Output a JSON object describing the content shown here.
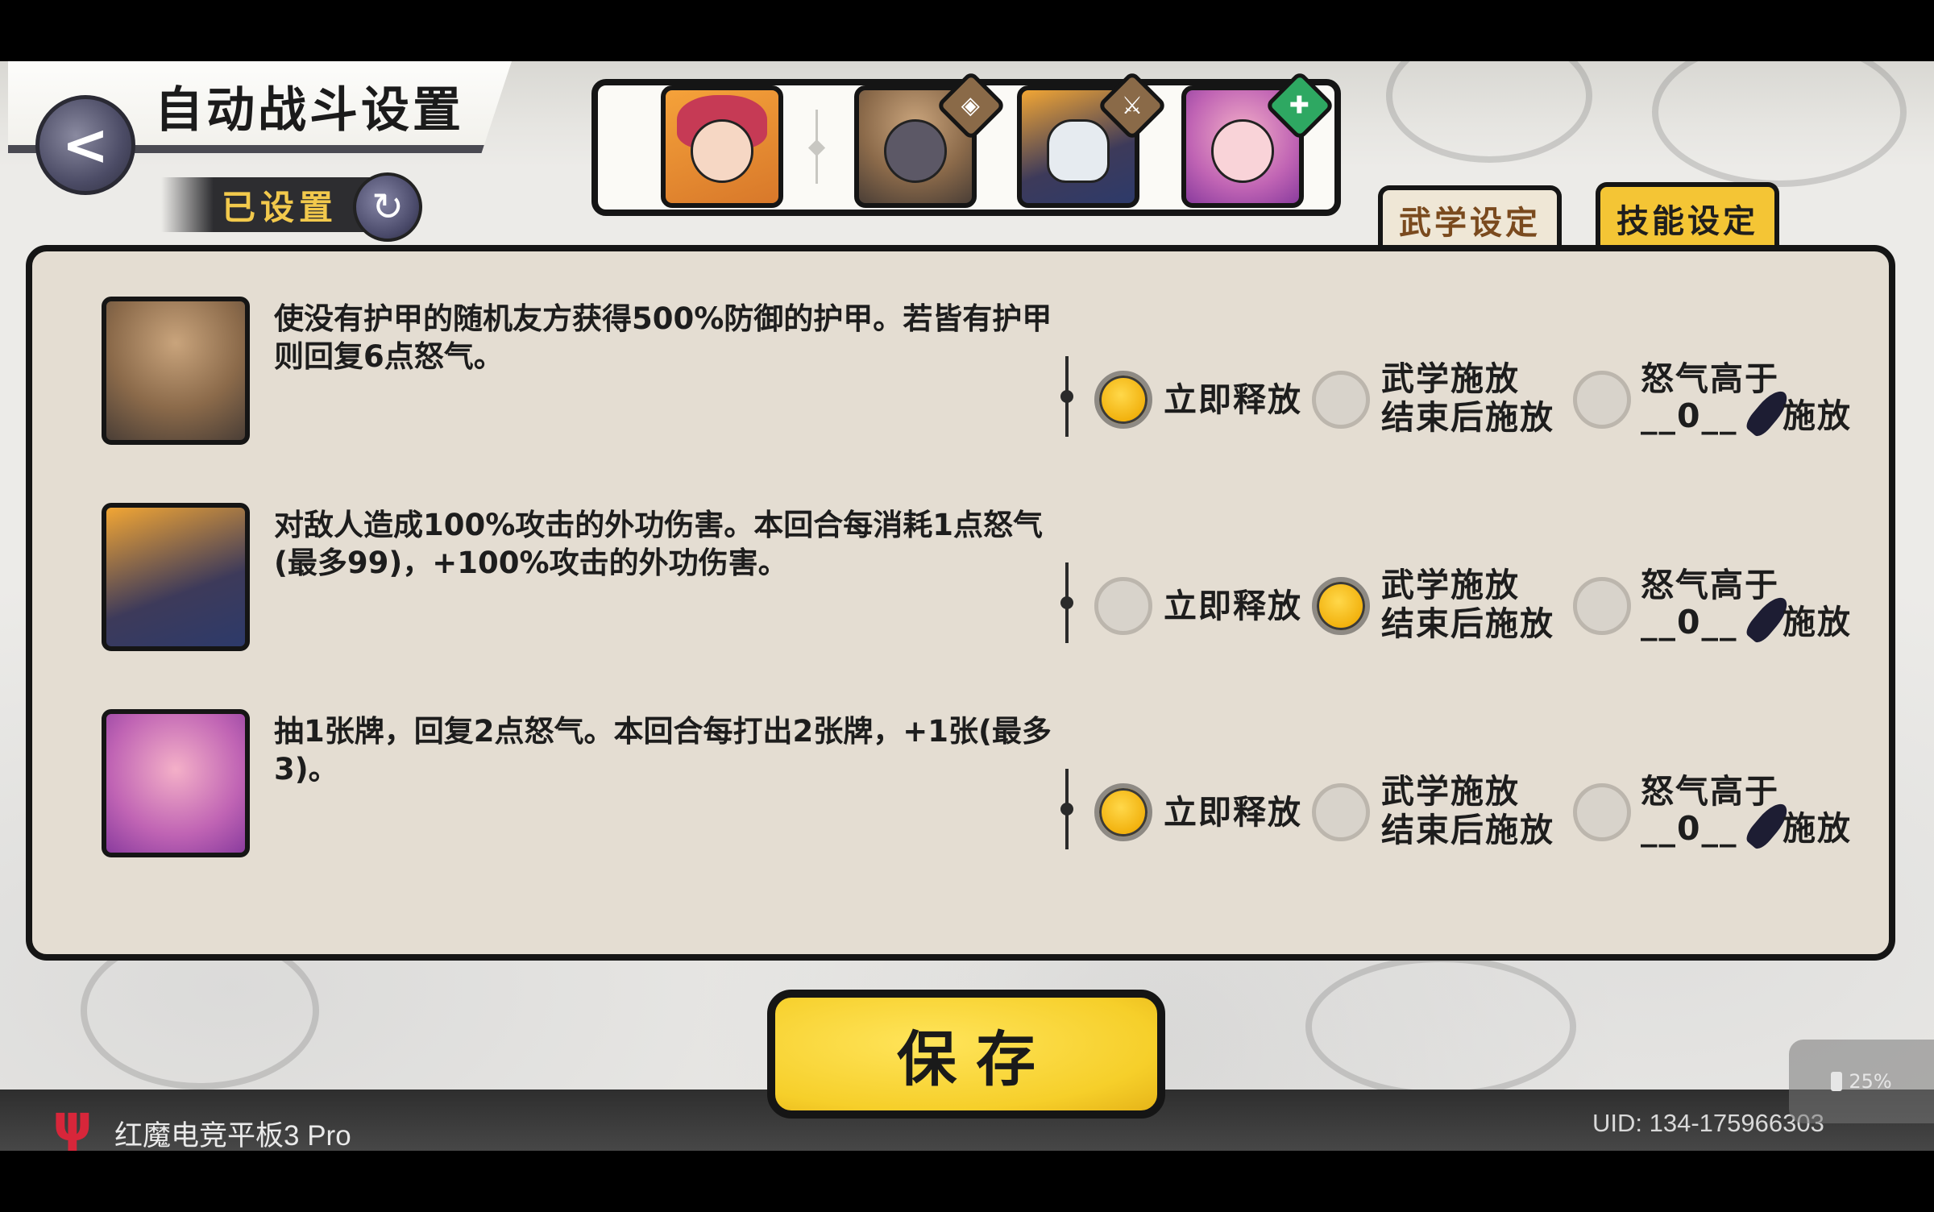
{
  "header": {
    "title": "自动战斗设置",
    "status_label": "已设置",
    "back_glyph": "<",
    "status_glyph": "↻"
  },
  "tabs": [
    {
      "label": "武学设定",
      "active": false
    },
    {
      "label": "技能设定",
      "active": true
    }
  ],
  "skills": [
    {
      "description": "使没有护甲的随机友方获得500%防御的护甲。若皆有护甲则回复6点怒气。",
      "selected": "immediate"
    },
    {
      "description": "对敌人造成100%攻击的外功伤害。本回合每消耗1点怒气(最多99)，+100%攻击的外功伤害。",
      "selected": "after_martial"
    },
    {
      "description": "抽1张牌，回复2点怒气。本回合每打出2张牌，+1张(最多3)。",
      "selected": "immediate"
    }
  ],
  "options": {
    "immediate_label": "立即释放",
    "after_martial_line1": "武学施放",
    "after_martial_line2": "结束后施放",
    "rage_line1": "怒气高于",
    "rage_value": "__0__",
    "rage_suffix": "施放"
  },
  "save_button": "保存",
  "device": {
    "name": "红魔电竞平板3 Pro",
    "uid": "UID:  134-175966303",
    "battery": "25%"
  },
  "colors": {
    "accent_gold": "#f4c535",
    "panel_bg": "#e4ddd2",
    "outline": "#151515"
  }
}
